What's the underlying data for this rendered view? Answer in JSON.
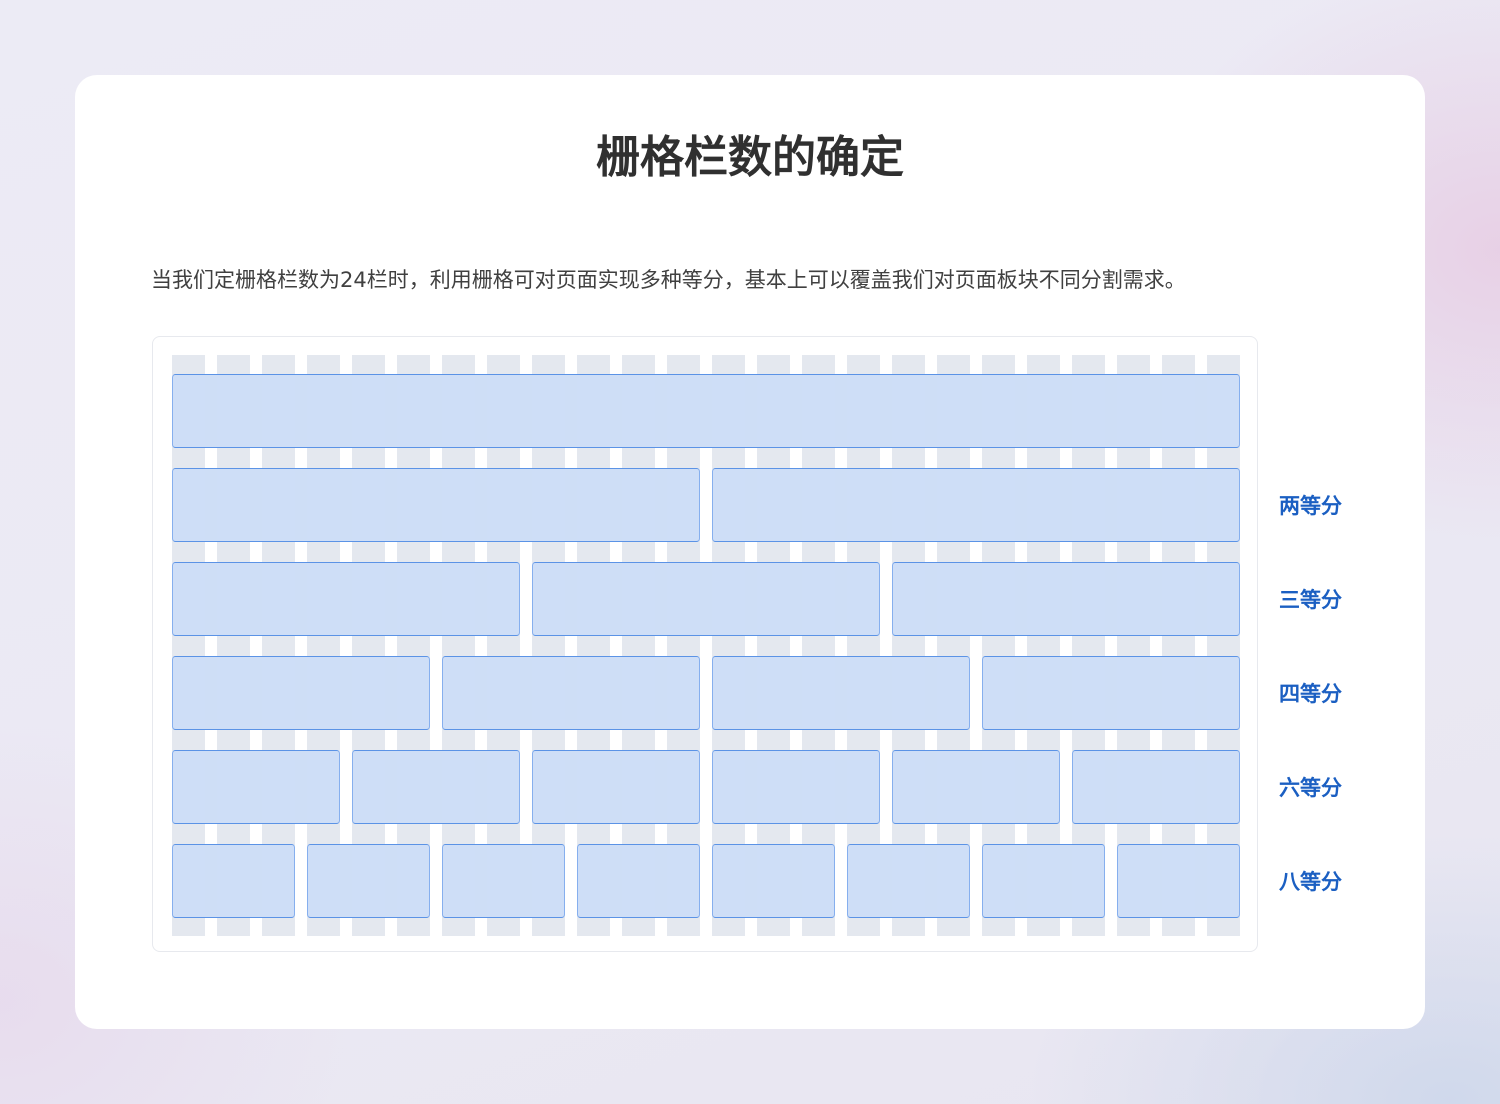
{
  "title": "栅格栏数的确定",
  "description": "当我们定栅格栏数为24栏时，利用栅格可对页面实现多种等分，基本上可以覆盖我们对页面板块不同分割需求。",
  "grid": {
    "columns": 24,
    "column_color": "#e4e8ef",
    "gutter_color": "#ffffff",
    "block_fill": "#c6d8f4",
    "block_stroke": "#5b93e6",
    "block_fill_opacity": 0.85,
    "column_stripe_tint": "#d8e6fd",
    "label_color": "#1b5fc2"
  },
  "rows": [
    {
      "divisions": 1,
      "label": ""
    },
    {
      "divisions": 2,
      "label": "两等分"
    },
    {
      "divisions": 3,
      "label": "三等分"
    },
    {
      "divisions": 4,
      "label": "四等分"
    },
    {
      "divisions": 6,
      "label": "六等分"
    },
    {
      "divisions": 8,
      "label": "八等分"
    }
  ]
}
